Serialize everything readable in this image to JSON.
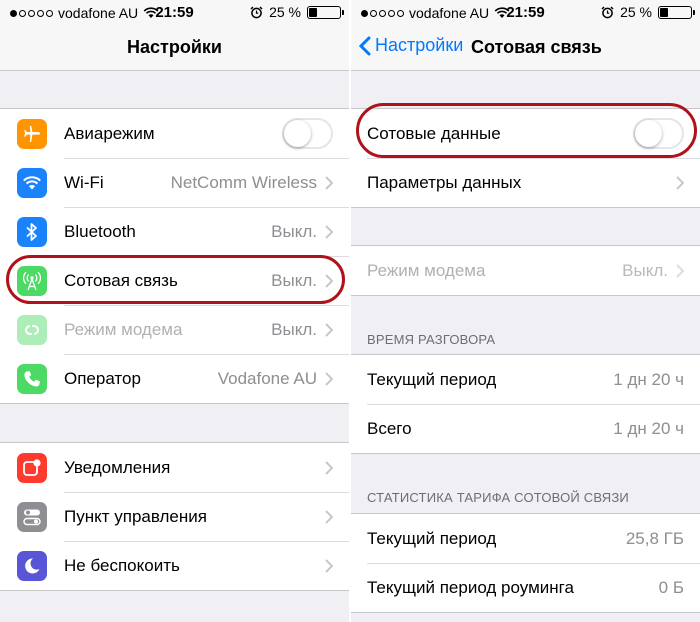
{
  "status": {
    "carrier": "vodafone AU",
    "time": "21:59",
    "battery": "25 %",
    "battery_level": 0.25
  },
  "left": {
    "nav_title": "Настройки",
    "group1": [
      {
        "label": "Авиарежим",
        "value": "",
        "icon": "airplane-icon",
        "color": "#ff9500"
      },
      {
        "label": "Wi-Fi",
        "value": "NetComm Wireless",
        "icon": "wifi-icon",
        "color": "#1a82fb"
      },
      {
        "label": "Bluetooth",
        "value": "Выкл.",
        "icon": "bluetooth-icon",
        "color": "#1a82fb"
      },
      {
        "label": "Сотовая связь",
        "value": "Выкл.",
        "icon": "cellular-icon",
        "color": "#4cd964"
      },
      {
        "label": "Режим модема",
        "value": "Выкл.",
        "icon": "hotspot-icon",
        "color": "#4cd964"
      },
      {
        "label": "Оператор",
        "value": "Vodafone AU",
        "icon": "phone-icon",
        "color": "#4cd964"
      }
    ],
    "group2": [
      {
        "label": "Уведомления",
        "icon": "notifications-icon",
        "color": "#ff3b30"
      },
      {
        "label": "Пункт управления",
        "icon": "control-center-icon",
        "color": "#8e8e93"
      },
      {
        "label": "Не беспокоить",
        "icon": "moon-icon",
        "color": "#5856d6"
      }
    ]
  },
  "right": {
    "back_label": "Настройки",
    "nav_title": "Сотовая связь",
    "cellular_data_label": "Сотовые данные",
    "data_options_label": "Параметры данных",
    "hotspot_label": "Режим модема",
    "hotspot_value": "Выкл.",
    "call_time_header": "ВРЕМЯ РАЗГОВОРА",
    "current_period_label": "Текущий период",
    "current_period_value": "1 дн 20 ч",
    "total_label": "Всего",
    "total_value": "1 дн 20 ч",
    "stats_header": "СТАТИСТИКА ТАРИФА СОТОВОЙ СВЯЗИ",
    "stats_current_label": "Текущий период",
    "stats_current_value": "25,8 ГБ",
    "stats_roaming_label": "Текущий период роуминга",
    "stats_roaming_value": "0 Б"
  },
  "colors": {
    "accent": "#007aff",
    "highlight": "#b0121a"
  }
}
